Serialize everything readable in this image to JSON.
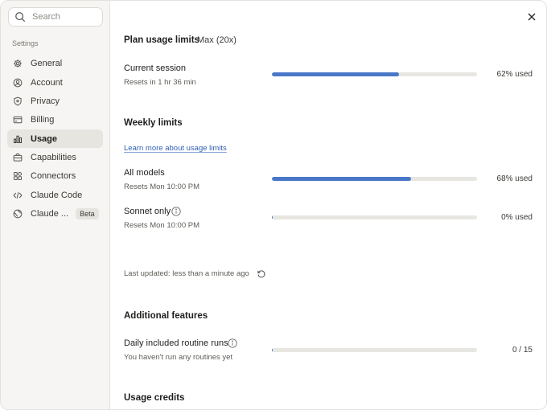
{
  "search": {
    "placeholder": "Search"
  },
  "sidebar": {
    "section_label": "Settings",
    "items": [
      {
        "label": "General",
        "icon": "gear-icon"
      },
      {
        "label": "Account",
        "icon": "user-circle-icon"
      },
      {
        "label": "Privacy",
        "icon": "shield-icon"
      },
      {
        "label": "Billing",
        "icon": "credit-card-icon"
      },
      {
        "label": "Usage",
        "icon": "bar-chart-icon",
        "active": true
      },
      {
        "label": "Capabilities",
        "icon": "briefcase-icon"
      },
      {
        "label": "Connectors",
        "icon": "connectors-icon"
      },
      {
        "label": "Claude Code",
        "icon": "code-icon"
      },
      {
        "label": "Claude ...",
        "icon": "globe-icon",
        "badge": "Beta"
      }
    ]
  },
  "plan": {
    "title": "Plan usage limits",
    "tier": "Max (20x)",
    "current_session": {
      "title": "Current session",
      "reset": "Resets in 1 hr 36 min",
      "used_percent": 62,
      "used_label": "62% used"
    }
  },
  "weekly": {
    "title": "Weekly limits",
    "learn_more": "Learn more about usage limits",
    "all_models": {
      "title": "All models",
      "reset": "Resets Mon 10:00 PM",
      "used_percent": 68,
      "used_label": "68% used"
    },
    "sonnet_only": {
      "title": "Sonnet only",
      "reset": "Resets Mon 10:00 PM",
      "used_percent": 0,
      "used_label": "0% used"
    }
  },
  "last_updated": "Last updated: less than a minute ago",
  "additional": {
    "title": "Additional features",
    "routine_runs": {
      "title": "Daily included routine runs",
      "sub": "You haven't run any routines yet",
      "used": 0,
      "total": 15,
      "count_label": "0 / 15"
    }
  },
  "usage_credits": {
    "title": "Usage credits"
  },
  "colors": {
    "accent": "#4a78c8",
    "sidebar_bg": "#f6f5f3",
    "active_bg": "#e7e5e0",
    "link": "#2f5fb3"
  }
}
